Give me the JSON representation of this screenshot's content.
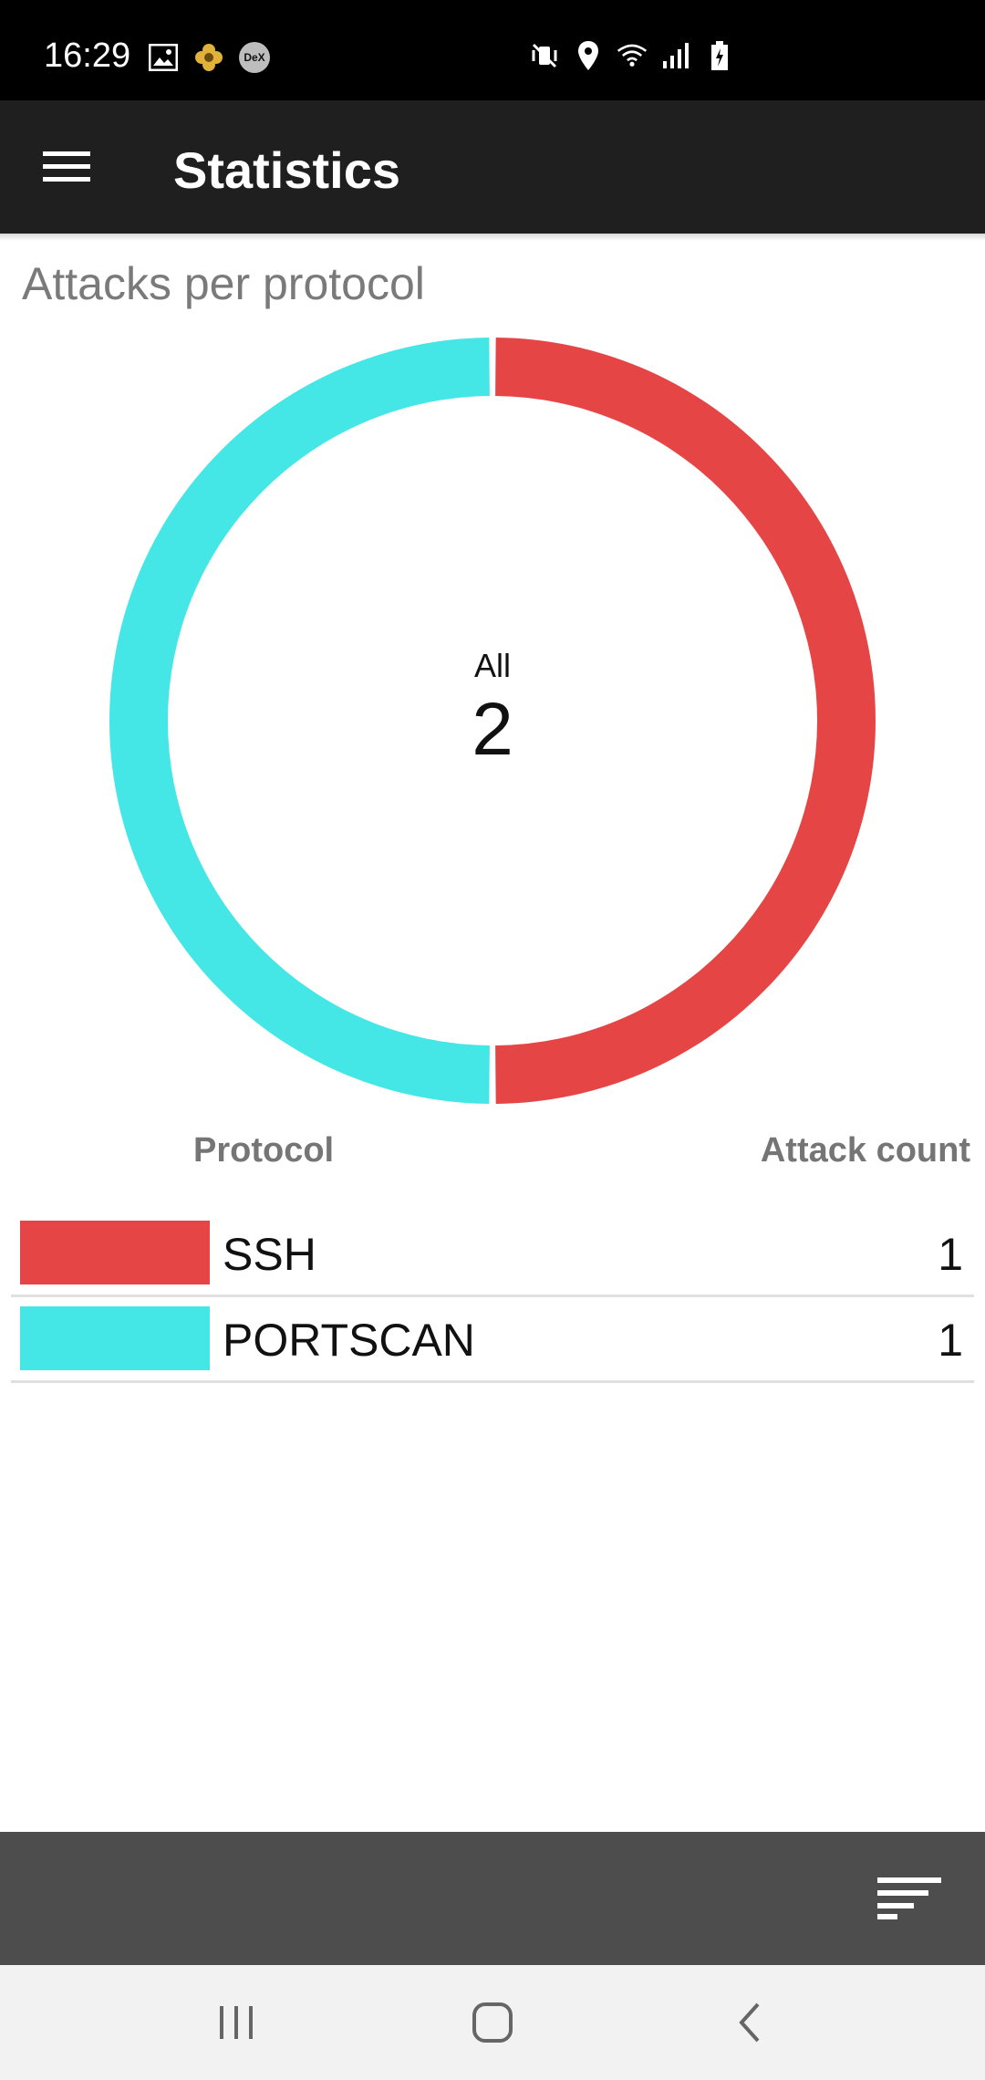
{
  "status_bar": {
    "time": "16:29",
    "left_icons": [
      "image-icon",
      "bee-app-icon",
      "dex-icon"
    ],
    "dex_label": "DeX",
    "right_icons": [
      "vibrate-mute-icon",
      "location-icon",
      "wifi-icon",
      "signal-icon",
      "battery-charging-icon"
    ]
  },
  "app_bar": {
    "title": "Statistics",
    "menu_icon": "hamburger-menu-icon"
  },
  "section": {
    "title": "Attacks per protocol"
  },
  "chart_data": {
    "type": "pie",
    "donut": true,
    "title": "Attacks per protocol",
    "center_label": "All",
    "center_value": "2",
    "categories": [
      "SSH",
      "PORTSCAN"
    ],
    "values": [
      1,
      1
    ],
    "colors": [
      "#e64545",
      "#45e6e6"
    ]
  },
  "legend": {
    "header_protocol": "Protocol",
    "header_count": "Attack count",
    "rows": [
      {
        "label": "SSH",
        "count": "1",
        "color": "#e64545"
      },
      {
        "label": "PORTSCAN",
        "count": "1",
        "color": "#45e6e6"
      }
    ]
  },
  "bottom_toolbar": {
    "filter_icon": "sort-filter-icon"
  },
  "nav_bar": {
    "buttons": [
      "recent-apps-icon",
      "home-icon",
      "back-icon"
    ]
  }
}
